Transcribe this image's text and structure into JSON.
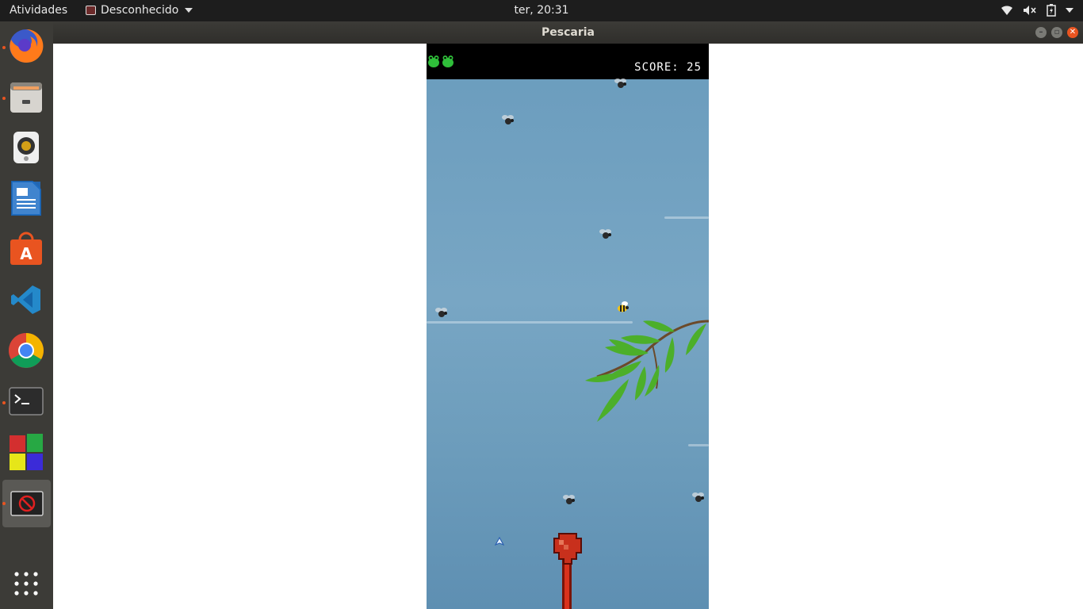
{
  "topbar": {
    "activities": "Atividades",
    "app_menu": "Desconhecido",
    "clock": "ter, 20:31",
    "tray_icons": [
      "wifi-icon",
      "volume-muted-icon",
      "battery-icon",
      "power-menu-icon"
    ]
  },
  "dock": {
    "items": [
      "firefox-icon",
      "files-icon",
      "rhythmbox-icon",
      "writer-icon",
      "software-icon",
      "vscode-icon",
      "chrome-icon",
      "terminal-icon",
      "game-app-icon",
      "blocked-app-icon",
      "show-apps-icon"
    ],
    "running_indicator_color": "#e95420"
  },
  "window": {
    "title": "Pescaria"
  },
  "game": {
    "score_text": "SCORE: 25",
    "lives": 2,
    "colors": {
      "hud": "#000000",
      "sky": "#6a9cbd",
      "frog": "#2fbf3a",
      "tongue": "#c8301c"
    }
  }
}
